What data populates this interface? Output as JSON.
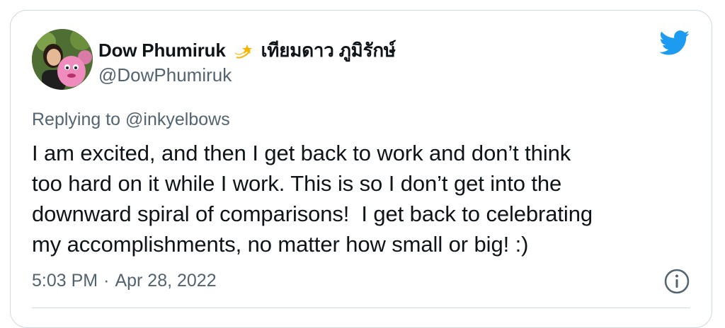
{
  "tweet": {
    "display_name": "Dow Phumiruk",
    "name_suffix_thai": "เทียมดาว ภูมิรักษ์",
    "handle": "@DowPhumiruk",
    "replying_prefix": "Replying to",
    "replying_to": "@inkyelbows",
    "text": "I am excited, and then I get back to work and don’t think\ntoo hard on it while I work. This is so I don’t get into the\ndownward spiral of comparisons!  I get back to celebrating\nmy accomplishments, no matter how small or big! :)",
    "time": "5:03 PM",
    "separator": "·",
    "date": "Apr 28, 2022"
  },
  "icons": {
    "avatar": "profile-photo",
    "name_emoji": "dizzy-star-icon",
    "logo": "twitter-bird-icon",
    "info": "info-icon"
  },
  "colors": {
    "twitter_blue": "#1d9bf0",
    "secondary_text": "#536471",
    "border": "#cfd9de",
    "emoji_star": "#f5b400"
  }
}
